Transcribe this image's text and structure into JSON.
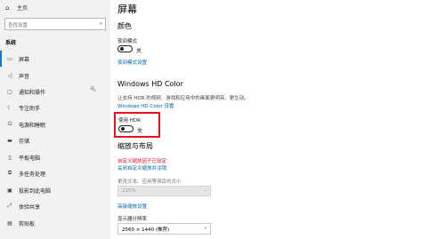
{
  "sidebar": {
    "home": {
      "label": "主页",
      "icon": "home-icon"
    },
    "search_placeholder": "查找设置",
    "section_title": "系统",
    "items": [
      {
        "label": "屏幕",
        "icon": "monitor-icon",
        "active": true
      },
      {
        "label": "声音",
        "icon": "speaker-icon"
      },
      {
        "label": "通知和操作",
        "icon": "notification-icon"
      },
      {
        "label": "专注助手",
        "icon": "moon-icon"
      },
      {
        "label": "电源和睡眠",
        "icon": "power-icon"
      },
      {
        "label": "存储",
        "icon": "storage-icon"
      },
      {
        "label": "平板电脑",
        "icon": "tablet-icon"
      },
      {
        "label": "多任务处理",
        "icon": "multitask-icon"
      },
      {
        "label": "投影到此电脑",
        "icon": "projector-icon"
      },
      {
        "label": "体验共享",
        "icon": "share-icon"
      },
      {
        "label": "剪贴板",
        "icon": "clipboard-icon"
      }
    ]
  },
  "main": {
    "title": "屏幕",
    "color_section": {
      "heading": "颜色",
      "night_light_label": "夜间模式",
      "night_light_state": "关",
      "night_light_link": "夜间模式设置"
    },
    "hdr_section": {
      "heading": "Windows HD Color",
      "description": "让支持 HDR 的视频、游戏和应用中的画面更明亮、更生动。",
      "settings_link": "Windows HD Color 设置",
      "use_hdr_label": "使用 HDR",
      "use_hdr_state": "关"
    },
    "scale_section": {
      "heading": "缩放与布局",
      "custom_scale_notice": "自定义缩放因子已设定",
      "custom_scale_link": "关闭自定义缩放并注销",
      "text_size_label": "更改文本、应用等项目的大小",
      "text_size_value": "225%",
      "advanced_link": "高级缩放设置",
      "resolution_label": "显示器分辨率",
      "resolution_value": "2560 × 1440 (推荐)"
    }
  },
  "colors": {
    "accent": "#0078d7",
    "link": "#0063b1",
    "highlight_box": "#e81123",
    "sidebar_bg": "#f2f2f2"
  }
}
